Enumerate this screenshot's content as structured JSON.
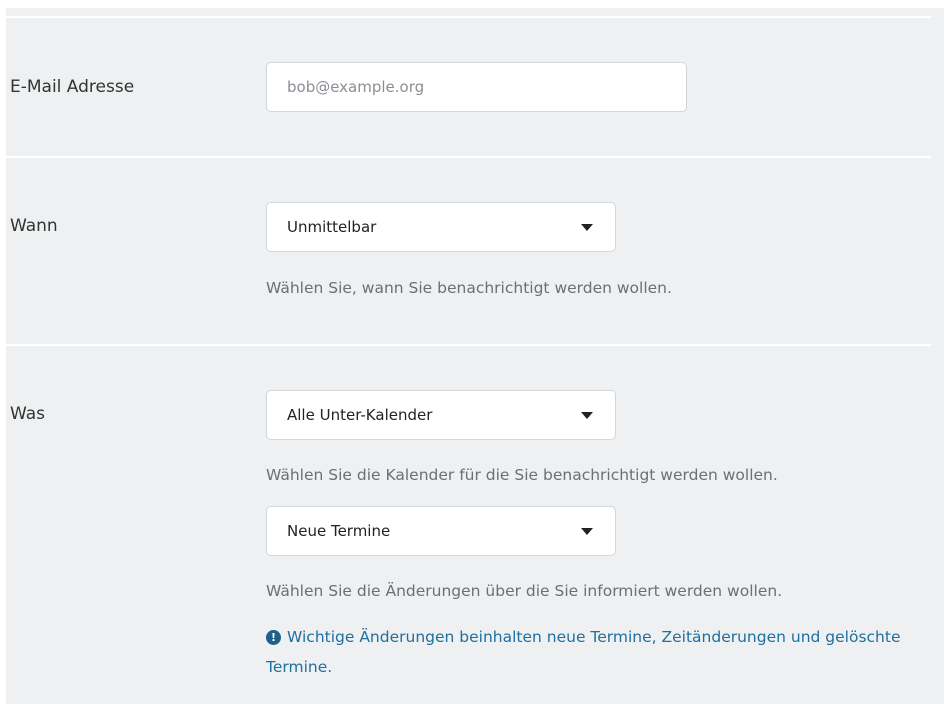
{
  "email": {
    "label": "E-Mail Adresse",
    "value": "",
    "placeholder": "bob@example.org"
  },
  "when": {
    "label": "Wann",
    "selected": "Unmittelbar",
    "help": "Wählen Sie, wann Sie benachrichtigt werden wollen."
  },
  "what": {
    "label": "Was",
    "calendar_selected": "Alle Unter-Kalender",
    "calendar_help": "Wählen Sie die Kalender für die Sie benachrichtigt werden wollen.",
    "changes_selected": "Neue Termine",
    "changes_help": "Wählen Sie die Änderungen über die Sie informiert werden wollen.",
    "info_icon": "exclamation-circle-icon",
    "info_text": "Wichtige Änderungen beinhalten neue Termine, Zeitänderungen und gelöschte Termine."
  },
  "colors": {
    "background": "#eef0f1",
    "info": "#1f6f9f"
  }
}
